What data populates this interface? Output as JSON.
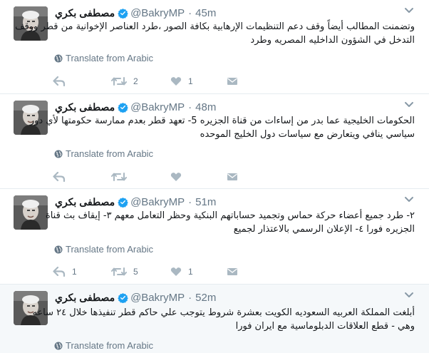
{
  "tweets": [
    {
      "name": "مصطفى بكري",
      "handle": "@BakryMP",
      "separator": "·",
      "time": "45m",
      "text": "وتضمنت المطالب أيضاً وقف دعم التنظيمات الإرهابية بكافة الصور ،طرد العناصر الإخوانية من قطر ووقف التدخل في الشؤون الداخليه المصريه وطرد",
      "translate": "Translate from Arabic",
      "replies": "",
      "retweets": "2",
      "likes": "1",
      "highlighted": false
    },
    {
      "name": "مصطفى بكري",
      "handle": "@BakryMP",
      "separator": "·",
      "time": "48m",
      "text": "الحكومات الخليجية عما بدر من إساءات من قناة الجزيره 5- تعهد قطر بعدم ممارسة حكومتها لأي دور سياسي ينافي ويتعارض مع سياسات دول الخليج الموحده",
      "translate": "Translate from Arabic",
      "replies": "",
      "retweets": "",
      "likes": "",
      "highlighted": false
    },
    {
      "name": "مصطفى بكري",
      "handle": "@BakryMP",
      "separator": "·",
      "time": "51m",
      "text": "٢- طرد جميع أعضاء حركة حماس وتجميد حساباتهم البنكية وحظر التعامل معهم ٣- إيقاف بث قناة الجزيره فورا ٤- الإعلان الرسمي بالاعتذار لجميع",
      "translate": "Translate from Arabic",
      "replies": "1",
      "retweets": "5",
      "likes": "1",
      "highlighted": false
    },
    {
      "name": "مصطفى بكري",
      "handle": "@BakryMP",
      "separator": "·",
      "time": "52m",
      "text": "أبلغت المملكة العربيه السعوديه الكويت بعشرة شروط يتوجب علي حاكم قطر تنفيذها خلال ٢٤ ساعه وهي - قطع العلاقات الدبلوماسية مع ايران فورا",
      "translate": "Translate from Arabic",
      "highlighted": true
    }
  ],
  "colors": {
    "name": "#14171a",
    "meta": "#657786",
    "icon": "#aab8c2",
    "verified": "#1da1f2",
    "border": "#e6ecf0",
    "highlight_bg": "#f5f8fa"
  },
  "icons": {
    "reply": "reply-icon",
    "retweet": "retweet-icon",
    "like": "heart-icon",
    "dm": "envelope-icon",
    "caret": "chevron-down-icon",
    "globe": "globe-icon",
    "verified": "verified-badge-icon"
  }
}
